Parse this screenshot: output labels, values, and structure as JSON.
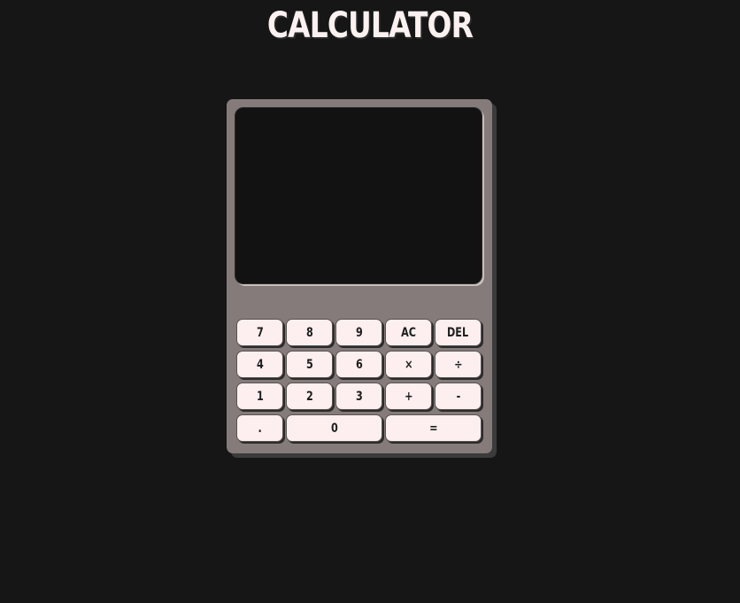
{
  "app": {
    "title": "CALCULATOR"
  },
  "display": {
    "value": ""
  },
  "keys": [
    [
      "7",
      "8",
      "9",
      "AC",
      "DEL"
    ],
    [
      "4",
      "5",
      "6",
      "×",
      "÷"
    ],
    [
      "1",
      "2",
      "3",
      "+",
      "-"
    ],
    [
      ".",
      "0",
      "="
    ]
  ],
  "colors": {
    "page_background": "#161616",
    "calculator_body": "#847b7a",
    "display_background": "#121212",
    "key_background": "#fdeff0",
    "title_text": "#fbf1f1"
  }
}
